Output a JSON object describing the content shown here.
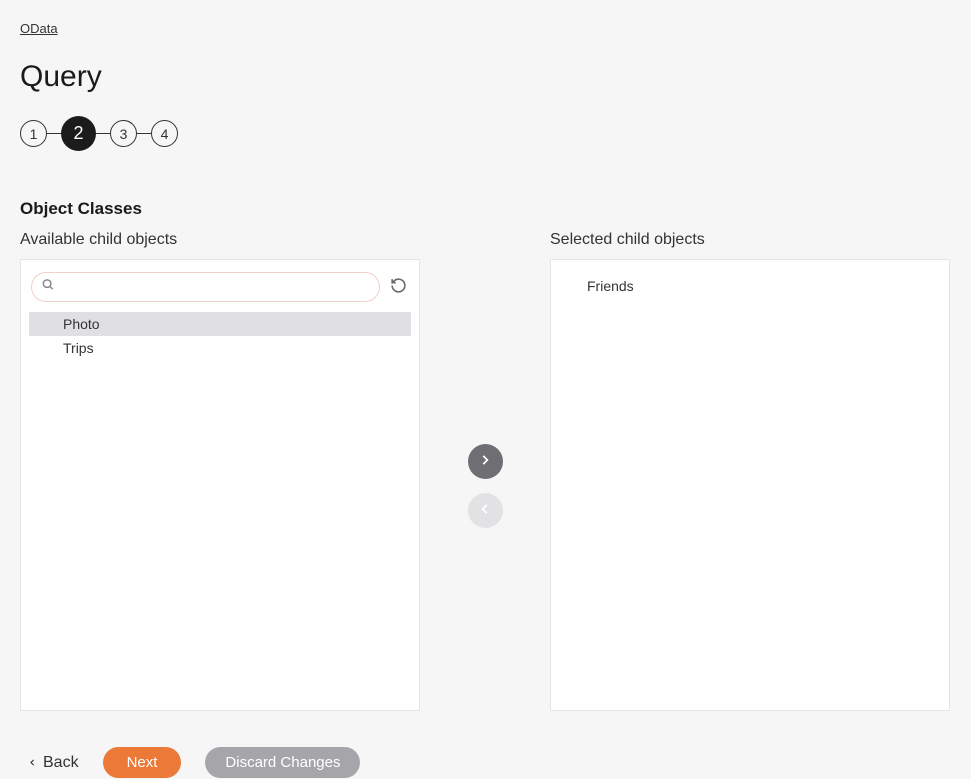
{
  "breadcrumb": "OData",
  "pageTitle": "Query",
  "stepper": {
    "steps": [
      "1",
      "2",
      "3",
      "4"
    ],
    "activeIndex": 1
  },
  "sectionTitle": "Object Classes",
  "availableLabel": "Available child objects",
  "selectedLabel": "Selected child objects",
  "searchValue": "",
  "availableItems": [
    {
      "label": "Photo",
      "highlighted": true
    },
    {
      "label": "Trips",
      "highlighted": false
    }
  ],
  "selectedItems": [
    {
      "label": "Friends"
    }
  ],
  "actions": {
    "back": "Back",
    "next": "Next",
    "discard": "Discard Changes"
  }
}
